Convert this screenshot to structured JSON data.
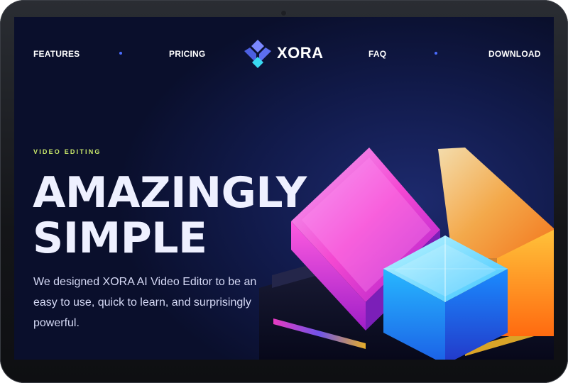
{
  "nav": {
    "links": [
      "FEATURES",
      "PRICING",
      "FAQ",
      "DOWNLOAD"
    ],
    "logo_text": "XORA"
  },
  "hero": {
    "eyebrow": "VIDEO EDITING",
    "title_lines": [
      "AMAZINGLY",
      "SIMPLE"
    ],
    "description": "We designed XORA AI Video Editor to be an easy to use, quick to learn, and surprisingly powerful."
  },
  "colors": {
    "background": "#0a0f2c",
    "accent": "#4a6cff",
    "eyebrow": "#c9e86a"
  },
  "icons": [
    "xora-logo-icon",
    "nav-separator-dot",
    "glowing-cubes-illustration"
  ]
}
